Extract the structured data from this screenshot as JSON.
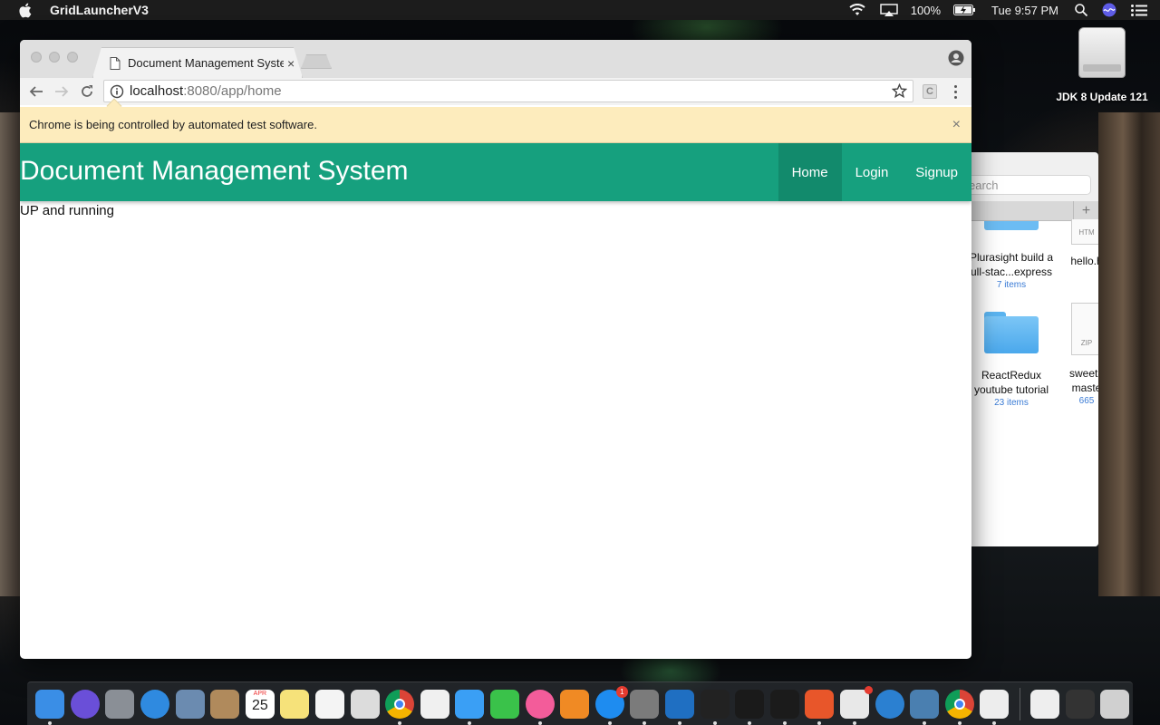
{
  "menubar": {
    "app_name": "GridLauncherV3",
    "battery": "100%",
    "clock": "Tue 9:57 PM"
  },
  "desktop": {
    "drive_label": "JDK 8 Update 121"
  },
  "finder": {
    "search_placeholder": "earch",
    "plus": "+",
    "items": [
      {
        "name": "Plurasight build a\nfull-stac...express",
        "line1": "Plurasight build a",
        "line2": "ull-stac...express",
        "count": "7 items"
      },
      {
        "name": "hello.",
        "line1": "hello.h",
        "line2": "",
        "count": ""
      },
      {
        "line1": "ReactRedux",
        "line2": "youtube tutorial",
        "count": "23 items"
      },
      {
        "line1": "sweeta",
        "line2": "maste",
        "count": "665"
      }
    ],
    "doc_labels": [
      "HTM",
      "ZIP"
    ]
  },
  "browser": {
    "tab_title": "Document Management System",
    "tab_close": "×",
    "url_host": "localhost",
    "url_path": ":8080/app/home",
    "ext_label": "C",
    "infobar_text": "Chrome is being controlled by automated test software.",
    "infobar_close": "×"
  },
  "app": {
    "brand": "Document Management System",
    "nav": [
      {
        "label": "Home",
        "active": true
      },
      {
        "label": "Login",
        "active": false
      },
      {
        "label": "Signup",
        "active": false
      }
    ],
    "status_text": "UP and running"
  },
  "dock": {
    "calendar_month": "APR",
    "calendar_day": "25",
    "appstore_badge": "1",
    "slack_badge": "",
    "items": [
      {
        "icon": "finder-icon",
        "color": "#3a8ee6"
      },
      {
        "icon": "siri-icon",
        "color": "#6a4fd8"
      },
      {
        "icon": "launchpad-icon",
        "color": "#8a8f96"
      },
      {
        "icon": "safari-icon",
        "color": "#2f8ae0"
      },
      {
        "icon": "preview-icon",
        "color": "#6b8bb0"
      },
      {
        "icon": "contacts-icon",
        "color": "#b08a5c"
      },
      {
        "icon": "calendar-icon",
        "color": "#ffffff"
      },
      {
        "icon": "notes-icon",
        "color": "#f6e27a"
      },
      {
        "icon": "reminders-icon",
        "color": "#f4f4f4"
      },
      {
        "icon": "photo-viewer-icon",
        "color": "#dcdcdc"
      },
      {
        "icon": "chrome-icon",
        "color": "#e8e8e8"
      },
      {
        "icon": "photos-icon",
        "color": "#f0f0f0"
      },
      {
        "icon": "messages-icon",
        "color": "#3a9ff5"
      },
      {
        "icon": "facetime-icon",
        "color": "#3ac24a"
      },
      {
        "icon": "itunes-icon",
        "color": "#f35c9a"
      },
      {
        "icon": "ibooks-icon",
        "color": "#f08a24"
      },
      {
        "icon": "appstore-icon",
        "color": "#1e8cf0"
      },
      {
        "icon": "system-preferences-icon",
        "color": "#7b7b7b"
      },
      {
        "icon": "vscode-icon",
        "color": "#1f6fc2"
      },
      {
        "icon": "terminal-icon",
        "color": "#222222"
      },
      {
        "icon": "terminal-2-icon",
        "color": "#1a1a1a"
      },
      {
        "icon": "intellij-icon",
        "color": "#1b1b1b"
      },
      {
        "icon": "postman-icon",
        "color": "#e8562a"
      },
      {
        "icon": "slack-icon",
        "color": "#e8e8e8"
      },
      {
        "icon": "ie-icon",
        "color": "#2b80d1"
      },
      {
        "icon": "postgres-icon",
        "color": "#4a7fb0"
      },
      {
        "icon": "chrome-2-icon",
        "color": "#e8e8e8"
      },
      {
        "icon": "java-icon",
        "color": "#ededed"
      }
    ],
    "right_items": [
      {
        "icon": "jar-file-icon",
        "color": "#eeeeee"
      },
      {
        "icon": "screenshot-icon",
        "color": "#333333"
      },
      {
        "icon": "trash-icon",
        "color": "#d0d0d0"
      }
    ]
  }
}
